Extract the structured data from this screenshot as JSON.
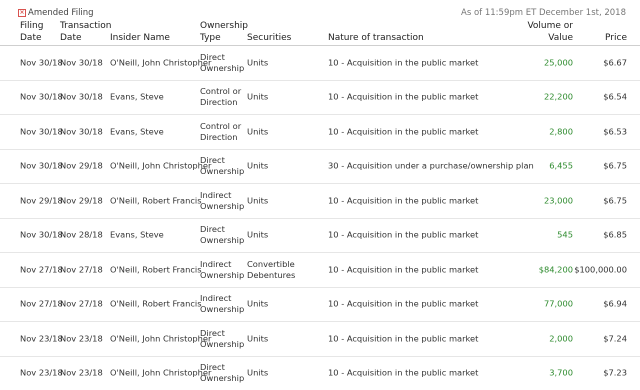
{
  "legend": {
    "icon": "amended-flag-icon",
    "label": "Amended Filing"
  },
  "as_of": "As of 11:59pm ET December 1st, 2018",
  "columns": {
    "filing_date": [
      "Filing",
      "Date"
    ],
    "transaction_date": [
      "Transaction",
      "Date"
    ],
    "insider_name": "Insider Name",
    "ownership_type": [
      "Ownership",
      "Type"
    ],
    "securities": "Securities",
    "nature": "Nature of transaction",
    "volume": [
      "Volume or",
      "Value"
    ],
    "price": "Price"
  },
  "rows": [
    {
      "filing": "Nov 30/18",
      "trans": "Nov 30/18",
      "name": "O'Neill, John Christopher",
      "own": [
        "Direct",
        "Ownership"
      ],
      "sec": [
        "Units"
      ],
      "nature": "10 - Acquisition in the public market",
      "volume": "25,000",
      "price": "$6.67"
    },
    {
      "filing": "Nov 30/18",
      "trans": "Nov 30/18",
      "name": "Evans, Steve",
      "own": [
        "Control or",
        "Direction"
      ],
      "sec": [
        "Units"
      ],
      "nature": "10 - Acquisition in the public market",
      "volume": "22,200",
      "price": "$6.54"
    },
    {
      "filing": "Nov 30/18",
      "trans": "Nov 30/18",
      "name": "Evans, Steve",
      "own": [
        "Control or",
        "Direction"
      ],
      "sec": [
        "Units"
      ],
      "nature": "10 - Acquisition in the public market",
      "volume": "2,800",
      "price": "$6.53"
    },
    {
      "filing": "Nov 30/18",
      "trans": "Nov 29/18",
      "name": "O'Neill, John Christopher",
      "own": [
        "Direct",
        "Ownership"
      ],
      "sec": [
        "Units"
      ],
      "nature": "30 - Acquisition under a purchase/ownership plan",
      "volume": "6,455",
      "price": "$6.75"
    },
    {
      "filing": "Nov 29/18",
      "trans": "Nov 29/18",
      "name": "O'Neill, Robert Francis",
      "own": [
        "Indirect",
        "Ownership"
      ],
      "sec": [
        "Units"
      ],
      "nature": "10 - Acquisition in the public market",
      "volume": "23,000",
      "price": "$6.75"
    },
    {
      "filing": "Nov 30/18",
      "trans": "Nov 28/18",
      "name": "Evans, Steve",
      "own": [
        "Direct",
        "Ownership"
      ],
      "sec": [
        "Units"
      ],
      "nature": "10 - Acquisition in the public market",
      "volume": "545",
      "price": "$6.85"
    },
    {
      "filing": "Nov 27/18",
      "trans": "Nov 27/18",
      "name": "O'Neill, Robert Francis",
      "own": [
        "Indirect",
        "Ownership"
      ],
      "sec": [
        "Convertible",
        "Debentures"
      ],
      "nature": "10 - Acquisition in the public market",
      "volume": "$84,200",
      "price": "$100,000.00"
    },
    {
      "filing": "Nov 27/18",
      "trans": "Nov 27/18",
      "name": "O'Neill, Robert Francis",
      "own": [
        "Indirect",
        "Ownership"
      ],
      "sec": [
        "Units"
      ],
      "nature": "10 - Acquisition in the public market",
      "volume": "77,000",
      "price": "$6.94"
    },
    {
      "filing": "Nov 23/18",
      "trans": "Nov 23/18",
      "name": "O'Neill, John Christopher",
      "own": [
        "Direct",
        "Ownership"
      ],
      "sec": [
        "Units"
      ],
      "nature": "10 - Acquisition in the public market",
      "volume": "2,000",
      "price": "$7.24"
    },
    {
      "filing": "Nov 23/18",
      "trans": "Nov 23/18",
      "name": "O'Neill, John Christopher",
      "own": [
        "Direct",
        "Ownership"
      ],
      "sec": [
        "Units"
      ],
      "nature": "10 - Acquisition in the public market",
      "volume": "3,700",
      "price": "$7.23"
    }
  ],
  "colors": {
    "volume_text": "#2e8b2e",
    "legend_icon": "#d9534f",
    "row_border": "#e6e6e6"
  }
}
